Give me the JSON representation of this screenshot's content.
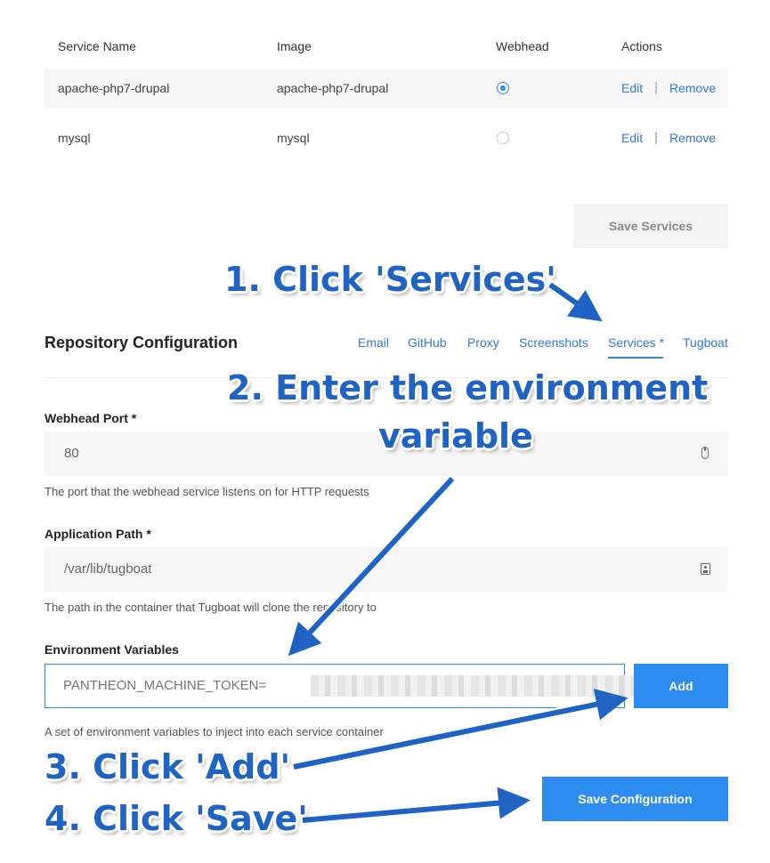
{
  "services_table": {
    "headers": [
      "Service Name",
      "Image",
      "Webhead",
      "Actions"
    ],
    "rows": [
      {
        "name": "apache-php7-drupal",
        "image": "apache-php7-drupal",
        "webhead": true,
        "edit": "Edit",
        "remove": "Remove"
      },
      {
        "name": "mysql",
        "image": "mysql",
        "webhead": false,
        "edit": "Edit",
        "remove": "Remove"
      }
    ],
    "save_label": "Save Services"
  },
  "repo_config": {
    "title": "Repository Configuration",
    "tabs": [
      "Email",
      "GitHub",
      "Proxy",
      "Screenshots",
      "Services *",
      "Tugboat"
    ],
    "active_tab": "Services *"
  },
  "form": {
    "webhead_port": {
      "label": "Webhead Port *",
      "value": "80",
      "help": "The port that the webhead service listens on for HTTP requests"
    },
    "app_path": {
      "label": "Application Path *",
      "value": "/var/lib/tugboat",
      "help": "The path in the container that Tugboat will clone the repository to"
    },
    "env_vars": {
      "label": "Environment Variables",
      "value": "PANTHEON_MACHINE_TOKEN=",
      "help": "A set of environment variables to inject into each service container",
      "add_label": "Add"
    },
    "save_label": "Save Configuration"
  },
  "annotations": {
    "step1": "1. Click 'Services'",
    "step2_line1": "2. Enter the environment",
    "step2_line2": "variable",
    "step3": "3. Click 'Add'",
    "step4": "4. Click 'Save'"
  },
  "colors": {
    "accent": "#2d8cf0",
    "link": "#2d7bd6",
    "annotation": "#1f63c4"
  }
}
